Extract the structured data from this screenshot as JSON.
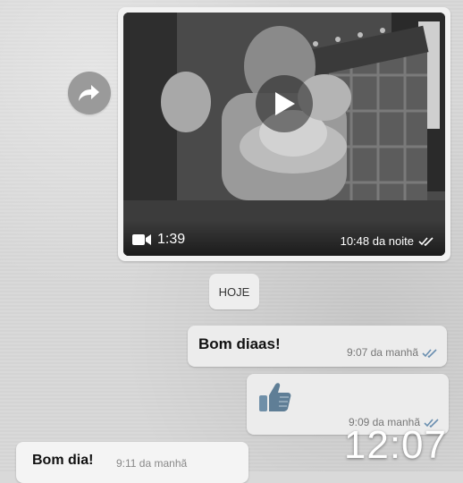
{
  "chat": {
    "video_message": {
      "duration": "1:39",
      "timestamp": "10:48 da noite",
      "status_icon": "double-check-icon",
      "play_icon": "play-icon",
      "video_icon": "video-camera-icon"
    },
    "forward_icon": "forward-icon",
    "date_divider": "HOJE",
    "messages": [
      {
        "direction": "outgoing",
        "text": "Bom diaas!",
        "time": "9:07 da manhã",
        "status_icon": "double-check-icon"
      },
      {
        "direction": "outgoing",
        "sticker": "thumbs-up-icon",
        "time": "9:09 da manhã",
        "status_icon": "double-check-icon"
      },
      {
        "direction": "incoming",
        "text": "Bom dia!",
        "time": "9:11 da manhã"
      }
    ]
  },
  "overlay": {
    "clock": "12:07"
  },
  "colors": {
    "background": "#d8d8d8",
    "bubble": "#ececec",
    "incoming_bubble": "#f4f4f4",
    "meta_text": "#777777"
  }
}
